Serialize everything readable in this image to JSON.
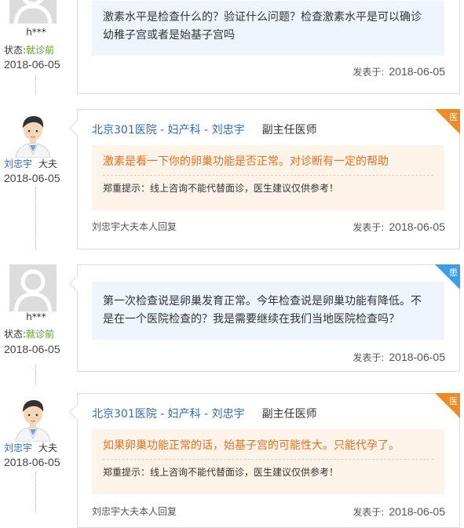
{
  "messages": [
    {
      "role": "patient",
      "user": "h***",
      "status_label": "状态:",
      "status_value": "就诊前",
      "date": "2018-06-05",
      "text_lines": [
        "激素水平是检查什么的？验证什么问题？检查激素水平是可以确诊",
        "幼稚子宫或者是始基子宫吗"
      ],
      "posted_label": "发表于:",
      "posted_date": "2018-06-05"
    },
    {
      "role": "doctor",
      "corner": "医",
      "avatar_name": "刘忠宇",
      "avatar_title": "大夫",
      "date": "2018-06-05",
      "header": "北京301医院 - 妇产科 - 刘忠宇",
      "rank": "副主任医师",
      "answer": "激素是看一下你的卵巢功能是否正常。对诊断有一定的帮助",
      "tip": "郑重提示：线上咨询不能代替面诊，医生建议仅供参考！",
      "reply_note": "刘忠宇大夫本人回复",
      "posted_label": "发表于:",
      "posted_date": "2018-06-05"
    },
    {
      "role": "patient",
      "corner": "患",
      "user": "h***",
      "status_label": "状态:",
      "status_value": "就诊前",
      "date": "2018-06-05",
      "text_lines": [
        "第一次检查说是卵巢发育正常。今年检查说是卵巢功能有降低。不",
        "是在一个医院检查的？我是需要继续在我们当地医院检查吗？"
      ],
      "posted_label": "发表于:",
      "posted_date": "2018-06-05"
    },
    {
      "role": "doctor",
      "corner": "医",
      "avatar_name": "刘忠宇",
      "avatar_title": "大夫",
      "date": "2018-06-05",
      "header": "北京301医院 - 妇产科 - 刘忠宇",
      "rank": "副主任医师",
      "answer": "如果卵巢功能正常的话，始基子宫的可能性大。只能代孕了。",
      "tip": "郑重提示：线上咨询不能代替面诊，医生建议仅供参考！",
      "reply_note": "刘忠宇大夫本人回复",
      "posted_label": "发表于:",
      "posted_date": "2018-06-05"
    }
  ]
}
